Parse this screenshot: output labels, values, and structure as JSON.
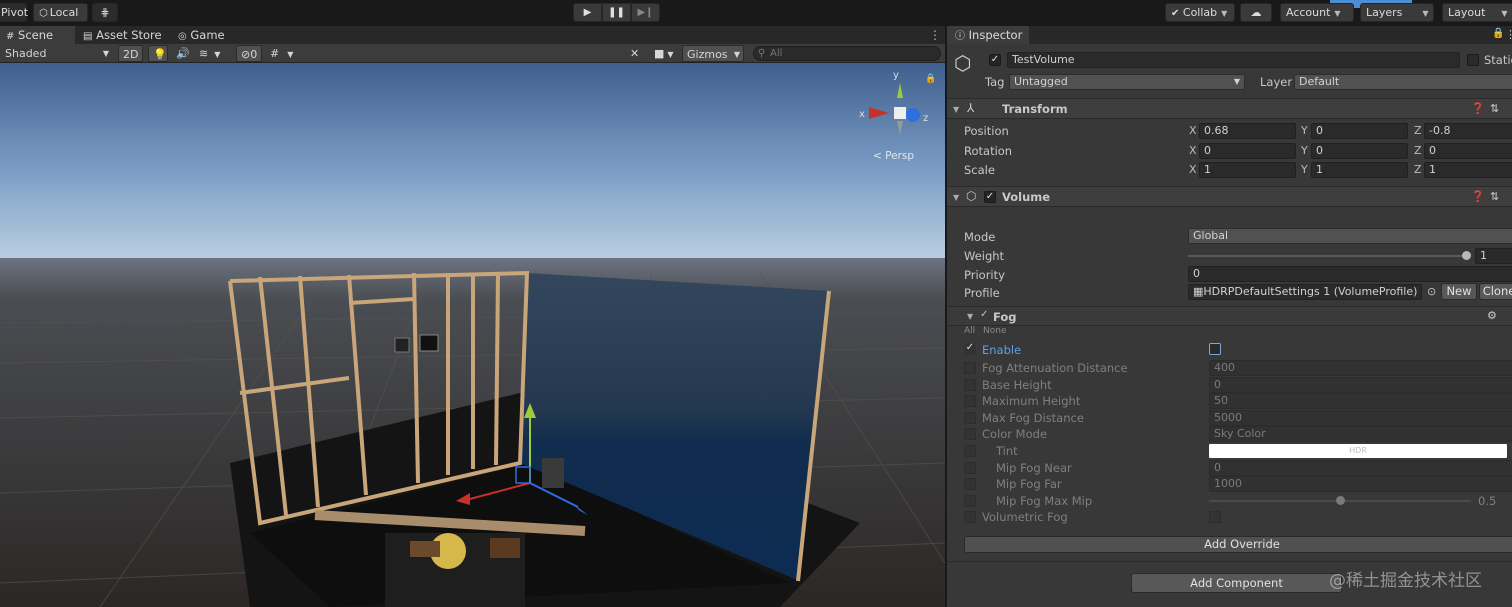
{
  "toolbar": {
    "pivot": "Pivot",
    "local": "Local",
    "collab": "Collab",
    "account": "Account",
    "layers": "Layers",
    "layout": "Layout"
  },
  "scene": {
    "tabs": [
      "Scene",
      "Asset Store",
      "Game"
    ],
    "shading_mode": "Shaded",
    "btn_2d": "2D",
    "hidden_count": "0",
    "gizmos": "Gizmos",
    "search_placeholder": "All",
    "gizmo_labels": {
      "x": "x",
      "y": "y",
      "z": "z"
    },
    "projection": "< Persp"
  },
  "inspector": {
    "tab": "Inspector",
    "object_name": "TestVolume",
    "static_label": "Static",
    "tag_label": "Tag",
    "tag_value": "Untagged",
    "layer_label": "Layer",
    "layer_value": "Default",
    "transform": {
      "title": "Transform",
      "rows": [
        {
          "label": "Position",
          "x": "0.68",
          "y": "0",
          "z": "-0.8"
        },
        {
          "label": "Rotation",
          "x": "0",
          "y": "0",
          "z": "0"
        },
        {
          "label": "Scale",
          "x": "1",
          "y": "1",
          "z": "1"
        }
      ]
    },
    "volume": {
      "title": "Volume",
      "mode_label": "Mode",
      "mode_value": "Global",
      "weight_label": "Weight",
      "weight_value": "1",
      "weight_fraction": 1.0,
      "priority_label": "Priority",
      "priority_value": "0",
      "profile_label": "Profile",
      "profile_value": "HDRPDefaultSettings 1 (VolumeProfile)",
      "new_label": "New",
      "clone_label": "Clone"
    },
    "fog": {
      "title": "Fog",
      "all_label": "All",
      "none_label": "None",
      "enable_label": "Enable",
      "properties": [
        {
          "label": "Fog Attenuation Distance",
          "value": "400"
        },
        {
          "label": "Base Height",
          "value": "0"
        },
        {
          "label": "Maximum Height",
          "value": "50"
        },
        {
          "label": "Max Fog Distance",
          "value": "5000"
        },
        {
          "label": "Color Mode",
          "value": "Sky Color"
        },
        {
          "label": "Tint",
          "value": "HDR"
        },
        {
          "label": "Mip Fog Near",
          "value": "0"
        },
        {
          "label": "Mip Fog Far",
          "value": "1000"
        },
        {
          "label": "Mip Fog Max Mip",
          "value": "0.5",
          "fraction": 0.5
        },
        {
          "label": "Volumetric Fog",
          "value": ""
        }
      ]
    },
    "add_override": "Add Override",
    "add_component": "Add Component"
  },
  "watermark": "@稀土掘金技术社区",
  "colors": {
    "toolbar_bg": "#191919",
    "panel_bg": "#383838",
    "enable_label": "#5aa0e6",
    "gizmo_x": "#c8312a",
    "gizmo_y": "#9ccc3a",
    "gizmo_z": "#2d6ee0"
  }
}
